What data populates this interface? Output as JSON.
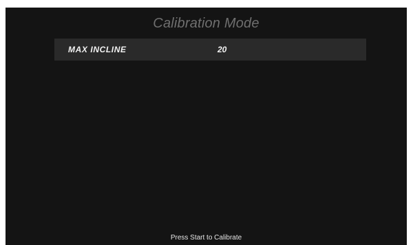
{
  "header": {
    "title": "Calibration Mode"
  },
  "settings": {
    "items": [
      {
        "label": "MAX INCLINE",
        "value": "20"
      }
    ]
  },
  "footer": {
    "hint": "Press Start to Calibrate"
  },
  "colors": {
    "background": "#141414",
    "row_background": "#2a2a2a",
    "title_text": "#6f6f6f",
    "primary_text": "#f2f2f2"
  }
}
